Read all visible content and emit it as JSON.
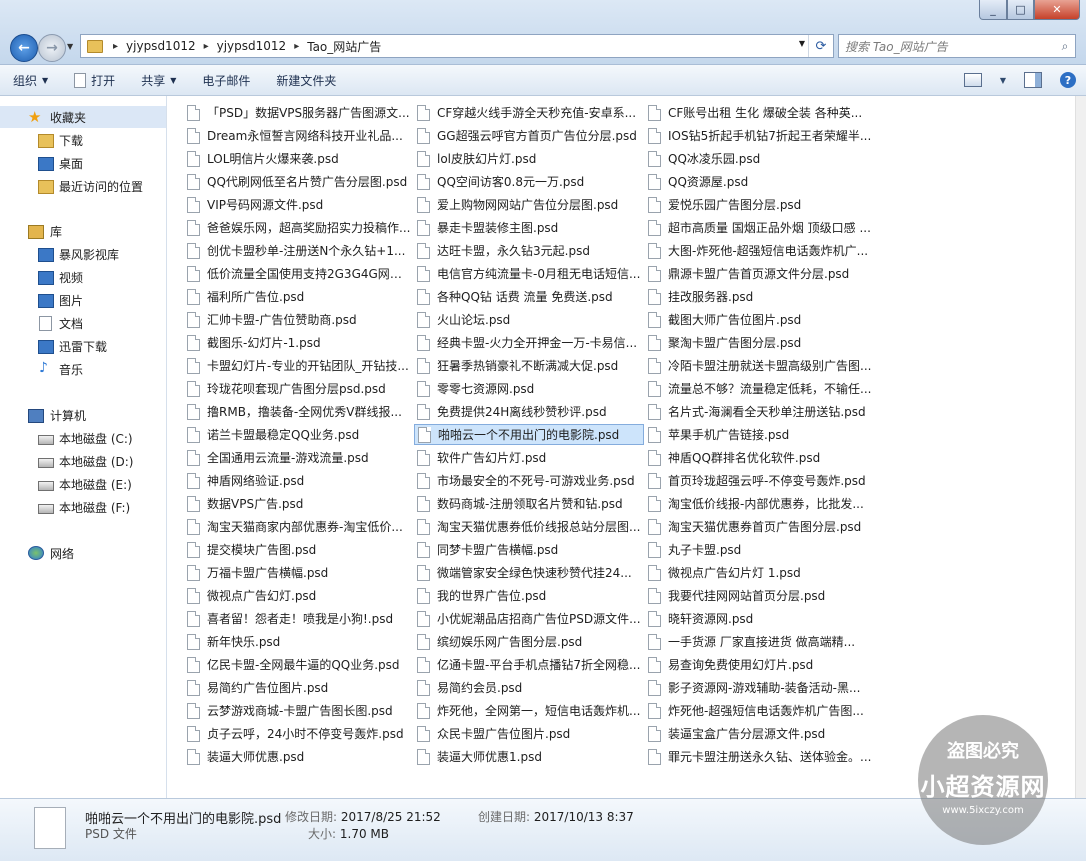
{
  "window": {
    "controls": [
      "_",
      "□",
      "✕"
    ]
  },
  "address": {
    "crumbs": [
      "yjypsd1012",
      "yjypsd1012",
      "Tao_网站广告"
    ]
  },
  "search": {
    "placeholder": "搜索 Tao_网站广告"
  },
  "toolbar": {
    "organize": "组织",
    "open": "打开",
    "share": "共享",
    "email": "电子邮件",
    "new_folder": "新建文件夹"
  },
  "sidebar": {
    "favorites": "收藏夹",
    "downloads": "下载",
    "desktop": "桌面",
    "recent": "最近访问的位置",
    "libraries": "库",
    "storm_video": "暴风影视库",
    "video": "视频",
    "pictures": "图片",
    "documents": "文档",
    "thunder": "迅雷下载",
    "music": "音乐",
    "computer": "计算机",
    "disk_c": "本地磁盘 (C:)",
    "disk_d": "本地磁盘 (D:)",
    "disk_e": "本地磁盘 (E:)",
    "disk_f": "本地磁盘 (F:)",
    "network": "网络"
  },
  "files": {
    "col1": [
      "「PSD」数据VPS服务器广告图源文...",
      "Dream永恒誓言网络科技开业礼品...",
      "LOL明信片火爆来袭.psd",
      "QQ代刷网低至名片赞广告分层图.psd",
      "VIP号码网源文件.psd",
      "爸爸娱乐网，超高奖励招实力投稿作...",
      "创优卡盟秒单-注册送N个永久钻+1...",
      "低价流量全国使用支持2G3G4G网络...",
      "福利所广告位.psd",
      "汇帅卡盟-广告位赞助商.psd",
      "截图乐-幻灯片-1.psd",
      "卡盟幻灯片-专业的开钻团队_开钻技...",
      "玲珑花呗套现广告图分层psd.psd",
      "撸RMB，撸装备-全网优秀V群线报...",
      "诺兰卡盟最稳定QQ业务.psd",
      "全国通用云流量-游戏流量.psd",
      "神盾网络验证.psd",
      "数据VPS广告.psd",
      "淘宝天猫商家内部优惠券-淘宝低价...",
      "提交模块广告图.psd",
      "万福卡盟广告横幅.psd",
      "微视点广告幻灯.psd",
      "喜者留！怨者走！喷我是小狗!.psd",
      "新年快乐.psd",
      "亿民卡盟-全网最牛逼的QQ业务.psd",
      "易简约广告位图片.psd",
      "云梦游戏商城-卡盟广告图长图.psd",
      "贞子云呼，24小时不停变号轰炸.psd",
      "装逼大师优惠.psd"
    ],
    "col2": [
      "CF穿越火线手游全天秒充值-安卓系...",
      "GG超强云呼官方首页广告位分层.psd",
      "lol皮肤幻片灯.psd",
      "QQ空间访客0.8元一万.psd",
      "爱上购物网网站广告位分层图.psd",
      "暴走卡盟装修主图.psd",
      "达旺卡盟，永久钻3元起.psd",
      "电信官方纯流量卡-0月租无电话短信...",
      "各种QQ钻 话费 流量 免费送.psd",
      "火山论坛.psd",
      "经典卡盟-火力全开押金一万-卡易信...",
      "狂暑季热销豪礼不断满减大促.psd",
      "零零七资源网.psd",
      "免费提供24H离线秒赞秒评.psd",
      "啪啪云一个不用出门的电影院.psd",
      "软件广告幻片灯.psd",
      "市场最安全的不死号-可游戏业务.psd",
      "数码商城-注册领取名片赞和钻.psd",
      "淘宝天猫优惠券低价线报总站分层图...",
      "同梦卡盟广告横幅.psd",
      "微端管家安全绿色快速秒赞代挂24...",
      "我的世界广告位.psd",
      "小优妮潮品店招商广告位PSD源文件...",
      "缤纫娱乐网广告图分层.psd",
      "亿通卡盟-平台手机点播钻7折全网稳...",
      "易简约会员.psd",
      "炸死他，全网第一，短信电话轰炸机...",
      "众民卡盟广告位图片.psd",
      "装逼大师优惠1.psd"
    ],
    "col3": [
      "CF账号出租 生化 爆破全装 各种英...",
      "IOS钻5折起手机钻7折起王者荣耀半...",
      "QQ冰凌乐园.psd",
      "QQ资源屋.psd",
      "爱悦乐园广告图分层.psd",
      "超市高质量 国烟正品外烟 顶级口感 ...",
      "大图-炸死他-超强短信电话轰炸机广...",
      "鼎源卡盟广告首页源文件分层.psd",
      "挂改服务器.psd",
      "截图大师广告位图片.psd",
      "聚淘卡盟广告图分层.psd",
      "冷陌卡盟注册就送卡盟高级别广告图...",
      "流量总不够？流量稳定低耗，不输任...",
      "名片式-海澜看全天秒单注册送钻.psd",
      "苹果手机广告链接.psd",
      "神盾QQ群排名优化软件.psd",
      "首页玲珑超强云呼-不停变号轰炸.psd",
      "淘宝低价线报-内部优惠券，比批发...",
      "淘宝天猫优惠券首页广告图分层.psd",
      "丸子卡盟.psd",
      "微视点广告幻片灯 1.psd",
      "我要代挂网网站首页分层.psd",
      "晓轩资源网.psd",
      "一手货源 厂家直接进货 做高端精...",
      "易查询免费使用幻灯片.psd",
      "影子资源网-游戏辅助-装备活动-黑...",
      "炸死他-超强短信电话轰炸机广告图...",
      "装逼宝盒广告分层源文件.psd",
      "罪元卡盟注册送永久钻、送体验金。..."
    ]
  },
  "details": {
    "name": "啪啪云一个不用出门的电影院.psd",
    "type": "PSD 文件",
    "modified_label": "修改日期:",
    "modified": "2017/8/25 21:52",
    "size_label": "大小:",
    "size": "1.70 MB",
    "created_label": "创建日期:",
    "created": "2017/10/13 8:37"
  },
  "watermark": {
    "line1": "盗图必究",
    "line2": "小超资源网",
    "line3": "www.5ixczy.com"
  }
}
